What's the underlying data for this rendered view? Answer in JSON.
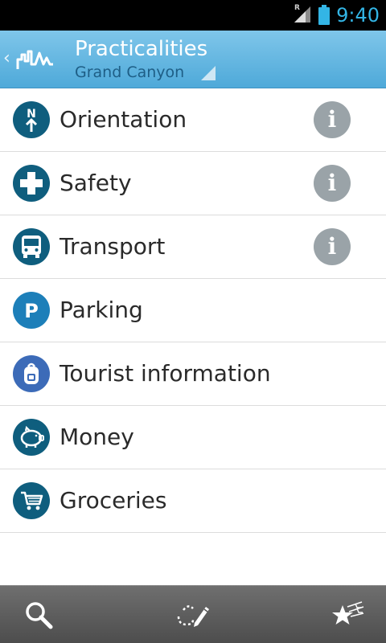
{
  "status_bar": {
    "roaming_indicator": "R",
    "time": "9:40",
    "icons": [
      "signal-icon",
      "battery-icon"
    ]
  },
  "action_bar": {
    "title": "Practicalities",
    "subtitle": "Grand Canyon",
    "icons": [
      "back-chevron-icon",
      "app-logo-icon",
      "dropdown-triangle-icon"
    ]
  },
  "list": {
    "items": [
      {
        "label": "Orientation",
        "icon": "compass-north-icon",
        "icon_color": "#0f5e7e",
        "has_info": true
      },
      {
        "label": "Safety",
        "icon": "first-aid-cross-icon",
        "icon_color": "#0f5e7e",
        "has_info": true
      },
      {
        "label": "Transport",
        "icon": "bus-icon",
        "icon_color": "#0f5e7e",
        "has_info": true
      },
      {
        "label": "Parking",
        "icon": "parking-icon",
        "icon_color": "#1d7fb9",
        "has_info": false
      },
      {
        "label": "Tourist information",
        "icon": "backpack-icon",
        "icon_color": "#3c6bb8",
        "has_info": false
      },
      {
        "label": "Money",
        "icon": "piggy-bank-icon",
        "icon_color": "#0f5e7e",
        "has_info": false
      },
      {
        "label": "Groceries",
        "icon": "shopping-cart-icon",
        "icon_color": "#0f5e7e",
        "has_info": false
      }
    ],
    "info_glyph": "i"
  },
  "bottom_bar": {
    "tools": [
      "search-icon",
      "route-pen-icon",
      "favorites-stars-icon"
    ]
  },
  "colors": {
    "action_bar_top": "#7fc6ea",
    "action_bar_bottom": "#4ea9d9",
    "status_clock": "#33b5e5",
    "info_button": "#9aa3a8"
  }
}
